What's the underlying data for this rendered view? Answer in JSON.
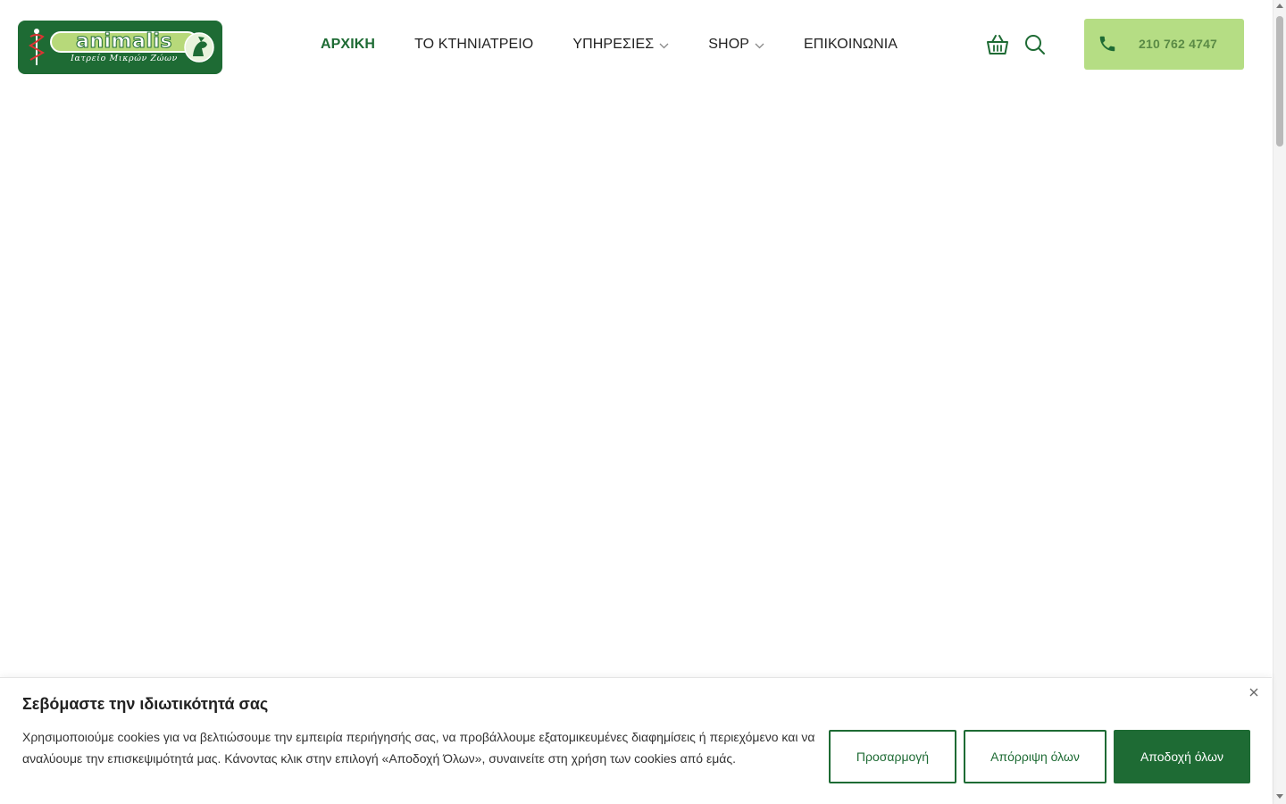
{
  "brand": {
    "name": "animalis",
    "tagline": "Ιατρείο Μικρών Ζώων",
    "primary_color": "#1e6b34",
    "accent_color": "#b5dd84"
  },
  "nav": {
    "items": [
      {
        "label": "ΑΡΧΙΚΗ",
        "active": true,
        "dropdown": false
      },
      {
        "label": "ΤΟ ΚΤΗΝΙΑΤΡΕΙΟ",
        "active": false,
        "dropdown": false
      },
      {
        "label": "ΥΠΗΡΕΣΙΕΣ",
        "active": false,
        "dropdown": true
      },
      {
        "label": "SHOP",
        "active": false,
        "dropdown": true
      },
      {
        "label": "ΕΠΙΚΟΙΝΩΝΙΑ",
        "active": false,
        "dropdown": false
      }
    ]
  },
  "header_icons": {
    "cart": "basket-icon",
    "search": "search-icon"
  },
  "phone": {
    "icon": "phone-icon",
    "number": "210 762 4747"
  },
  "cookie": {
    "title": "Σεβόμαστε την ιδιωτικότητά σας",
    "text": "Χρησιμοποιούμε cookies για να βελτιώσουμε την εμπειρία περιήγησής σας, να προβάλλουμε εξατομικευμένες διαφημίσεις ή περιεχόμενο και να αναλύουμε την επισκεψιμότητά μας. Κάνοντας κλικ στην επιλογή «Αποδοχή Όλων», συναινείτε στη χρήση των cookies από εμάς.",
    "customize_label": "Προσαρμογή",
    "reject_label": "Απόρριψη όλων",
    "accept_label": "Αποδοχή όλων",
    "close_icon": "close-icon"
  }
}
